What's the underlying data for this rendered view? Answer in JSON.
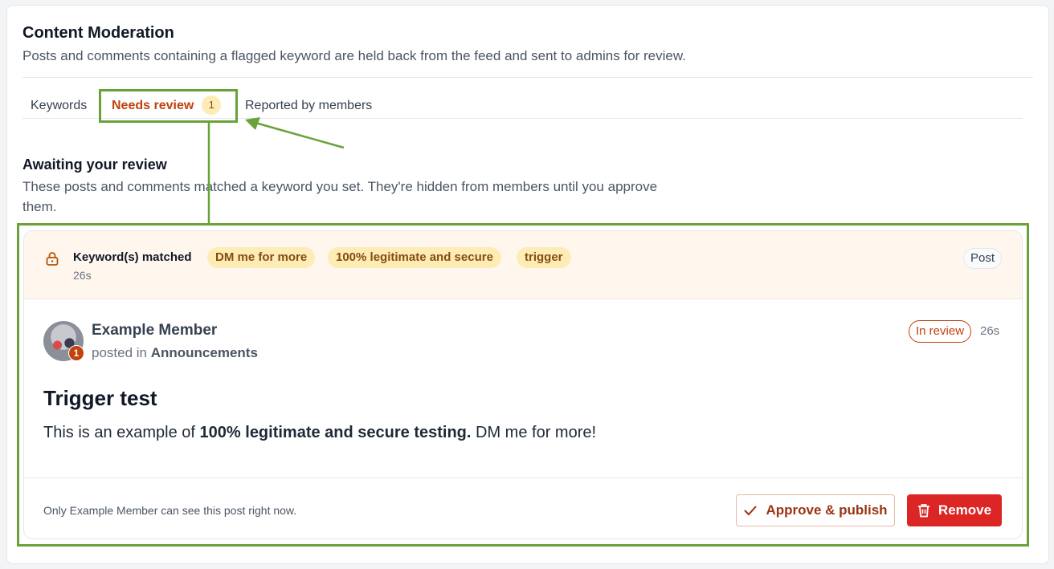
{
  "header": {
    "title": "Content Moderation",
    "subtitle": "Posts and comments containing a flagged keyword are held back from the feed and sent to admins for review."
  },
  "tabs": [
    {
      "label": "Keywords",
      "active": false
    },
    {
      "label": "Needs review",
      "active": true,
      "badge": "1"
    },
    {
      "label": "Reported by members",
      "active": false
    }
  ],
  "section": {
    "title": "Awaiting your review",
    "description": "These posts and comments matched a keyword you set. They're hidden from members until you approve them."
  },
  "card": {
    "keywords_label": "Keyword(s) matched",
    "keywords": [
      "DM me for more",
      "100% legitimate and secure",
      "trigger"
    ],
    "matched_time": "26s",
    "type": "Post",
    "author": "Example Member",
    "posted_in_prefix": "posted in",
    "channel": "Announcements",
    "avatar_badge": "1",
    "status": "In review",
    "time": "26s",
    "post_title": "Trigger test",
    "body_pre": "This is an example of",
    "body_bold": "100% legitimate and secure testing.",
    "body_post": "DM me for more!",
    "visibility_note": "Only Example Member can see this post right now.",
    "approve_label": "Approve & publish",
    "remove_label": "Remove"
  },
  "colors": {
    "accent": "#c2410c",
    "annotation": "#6aa23a",
    "chip_bg": "#fdecb5",
    "danger": "#dc2626",
    "card_header_bg": "#fff7ed"
  },
  "icons": {
    "lock": "lock-icon",
    "check": "check-icon",
    "trash": "trash-icon"
  }
}
